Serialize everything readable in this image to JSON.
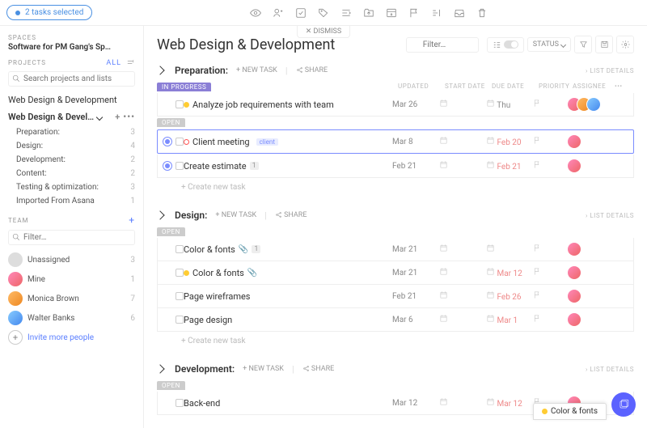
{
  "selectionBar": {
    "label": "2 tasks selected"
  },
  "dismiss": "✕ DISMISS",
  "sidebar": {
    "spacesLabel": "SPACES",
    "breadcrumb": "Software for PM Gang's Sp…",
    "projectsLabel": "PROJECTS",
    "allLabel": "All",
    "searchPh": "Search projects and lists",
    "projects": [
      "Web Design & Development",
      "Web Design & Devel…"
    ],
    "sub": [
      {
        "name": "Preparation:",
        "count": "3"
      },
      {
        "name": "Design:",
        "count": "4"
      },
      {
        "name": "Development:",
        "count": "2"
      },
      {
        "name": "Content:",
        "count": "2"
      },
      {
        "name": "Testing & optimization:",
        "count": "3"
      },
      {
        "name": "Imported From Asana",
        "count": "1"
      }
    ],
    "teamLabel": "TEAM",
    "filterPh": "Filter…",
    "members": [
      {
        "name": "Unassigned",
        "count": "3"
      },
      {
        "name": "Mine",
        "count": "1"
      },
      {
        "name": "Monica Brown",
        "count": "7"
      },
      {
        "name": "Walter Banks",
        "count": "6"
      }
    ],
    "invite": "Invite more people"
  },
  "page": {
    "title": "Web Design & Development",
    "filterPh": "Filter…",
    "statusLabel": "STATUS"
  },
  "misc": {
    "newTask": "+ NEW TASK",
    "share": "SHARE",
    "listDetails": "› LIST DETAILS",
    "createNew": "+   Create new task",
    "cols": {
      "updated": "UPDATED",
      "start": "START DATE",
      "due": "DUE DATE",
      "priority": "PRIORITY",
      "assignee": "ASSIGNEE"
    },
    "badges": {
      "inprogress": "IN PROGRESS",
      "open": "OPEN"
    },
    "panelPeek": "Color & fonts"
  },
  "sections": [
    {
      "title": "Preparation:",
      "groups": [
        {
          "badge": "inprogress",
          "tasks": [
            {
              "sel": false,
              "dot": "y",
              "name": "Analyze job requirements with team",
              "updated": "Mar 26",
              "due": "Thu",
              "dueRed": false,
              "avs": 3
            }
          ]
        },
        {
          "badge": "open",
          "tasks": [
            {
              "sel": true,
              "rad": true,
              "dot": "r",
              "name": "Client meeting",
              "tag": "client",
              "updated": "Mar 8",
              "due": "Feb 20",
              "dueRed": true,
              "avs": 1
            },
            {
              "sel": false,
              "rad": true,
              "name": "Create estimate",
              "cnt": "1",
              "updated": "Feb 21",
              "due": "Feb 21",
              "dueRed": true,
              "avs": 1
            }
          ]
        }
      ]
    },
    {
      "title": "Design:",
      "groups": [
        {
          "badge": "open",
          "tasks": [
            {
              "name": "Color & fonts",
              "clip": true,
              "cnt": "1",
              "updated": "Mar 21",
              "avs": 1
            },
            {
              "dot": "y",
              "name": "Color & fonts",
              "clip": true,
              "updated": "Mar 21",
              "due": "Mar 12",
              "dueRed": true,
              "avs": 1
            },
            {
              "name": "Page wireframes",
              "updated": "Feb 21",
              "due": "Feb 26",
              "dueRed": true,
              "avs": 1
            },
            {
              "name": "Page design",
              "updated": "Mar 6",
              "due": "Mar 1",
              "dueRed": true,
              "avs": 1
            }
          ]
        }
      ]
    },
    {
      "title": "Development:",
      "groups": [
        {
          "badge": "open",
          "tasks": [
            {
              "name": "Back-end",
              "updated": "Mar 12",
              "due": "Mar 12",
              "dueRed": true,
              "avs": 1
            }
          ]
        }
      ]
    }
  ]
}
